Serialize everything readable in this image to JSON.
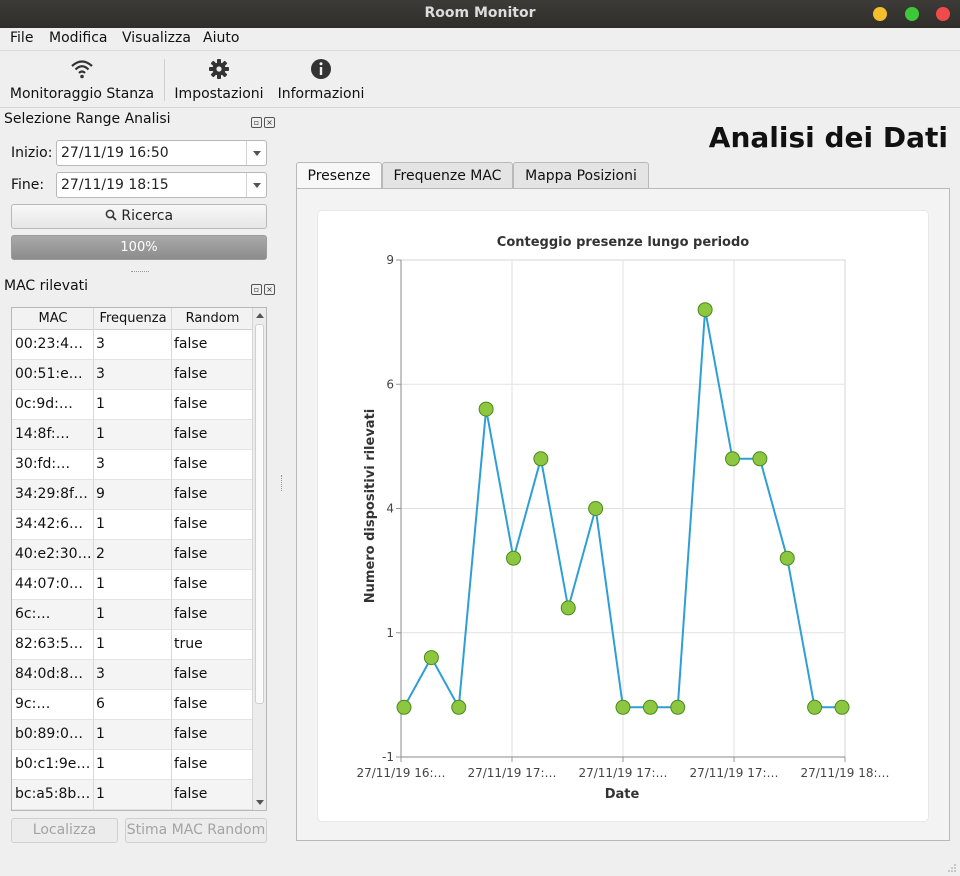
{
  "window": {
    "title": "Room Monitor"
  },
  "menu": [
    "File",
    "Modifica",
    "Visualizza",
    "Aiuto"
  ],
  "toolbar": {
    "monitor_label": "Monitoraggio Stanza",
    "settings_label": "Impostazioni",
    "info_label": "Informazioni"
  },
  "range_panel": {
    "title": "Selezione Range Analisi",
    "start_label": "Inizio:",
    "start_value": "27/11/19 16:50",
    "end_label": "Fine:",
    "end_value": "27/11/19 18:15",
    "search_label": "Ricerca",
    "progress_text": "100%",
    "progress_value": 100
  },
  "mac_panel": {
    "title": "MAC rilevati",
    "columns": [
      "MAC",
      "Frequenza",
      "Random"
    ],
    "rows": [
      [
        "00:23:4…",
        "3",
        "false"
      ],
      [
        "00:51:e…",
        "3",
        "false"
      ],
      [
        "0c:9d:…",
        "1",
        "false"
      ],
      [
        "14:8f:…",
        "1",
        "false"
      ],
      [
        "30:fd:…",
        "3",
        "false"
      ],
      [
        "34:29:8f…",
        "9",
        "false"
      ],
      [
        "34:42:6…",
        "1",
        "false"
      ],
      [
        "40:e2:30…",
        "2",
        "false"
      ],
      [
        "44:07:0…",
        "1",
        "false"
      ],
      [
        "6c:…",
        "1",
        "false"
      ],
      [
        "82:63:5…",
        "1",
        "true"
      ],
      [
        "84:0d:8…",
        "3",
        "false"
      ],
      [
        "9c:…",
        "6",
        "false"
      ],
      [
        "b0:89:0…",
        "1",
        "false"
      ],
      [
        "b0:c1:9e…",
        "1",
        "false"
      ],
      [
        "bc:a5:8b…",
        "1",
        "false"
      ]
    ],
    "localize_label": "Localizza",
    "estimate_label": "Stima MAC Random"
  },
  "main": {
    "title": "Analisi dei Dati",
    "tabs": [
      "Presenze",
      "Frequenze MAC",
      "Mappa Posizioni"
    ],
    "active_tab": 0
  },
  "chart_data": {
    "type": "line",
    "title": "Conteggio presenze lungo periodo",
    "xlabel": "Date",
    "ylabel": "Numero dispositivi rilevati",
    "ytick_labels": [
      "-1",
      "1",
      "4",
      "6",
      "9"
    ],
    "xtick_labels": [
      "27/11/19 16:…",
      "27/11/19 17:…",
      "27/11/19 17:…",
      "27/11/19 17:…",
      "27/11/19 18:…"
    ],
    "ylim": [
      -1,
      9
    ],
    "grid": true,
    "line_color": "#2e9fd6",
    "marker_color": "#8dc63f",
    "series": [
      {
        "values": [
          0,
          1,
          0,
          6,
          3,
          5,
          2,
          4,
          0,
          0,
          0,
          8,
          5,
          5,
          3,
          0,
          0
        ]
      }
    ]
  }
}
